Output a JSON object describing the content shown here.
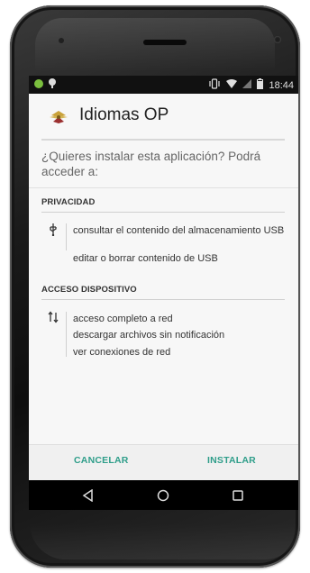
{
  "status_bar": {
    "time": "18:44",
    "icons": [
      "android-notification-icon",
      "location-pin-icon",
      "vibrate-icon",
      "wifi-icon",
      "signal-icon",
      "battery-icon"
    ]
  },
  "dialog": {
    "app_name": "Idiomas OP",
    "app_icon": "app-logo-icon",
    "question": "¿Quieres instalar esta aplicación? Podrá acceder a:",
    "sections": [
      {
        "label": "PRIVACIDAD",
        "icon": "usb-icon",
        "items": [
          "consultar el contenido del almacenamiento USB",
          "editar o borrar contenido de USB"
        ]
      },
      {
        "label": "ACCESO DISPOSITIVO",
        "icon": "network-arrows-icon",
        "items": [
          "acceso completo a red",
          "descargar archivos sin notificación",
          "ver conexiones de red"
        ]
      }
    ],
    "buttons": {
      "cancel": "CANCELAR",
      "install": "INSTALAR"
    },
    "accent_color": "#2f9e8a"
  },
  "nav_bar": {
    "buttons": [
      "back-icon",
      "home-icon",
      "recents-icon"
    ]
  }
}
